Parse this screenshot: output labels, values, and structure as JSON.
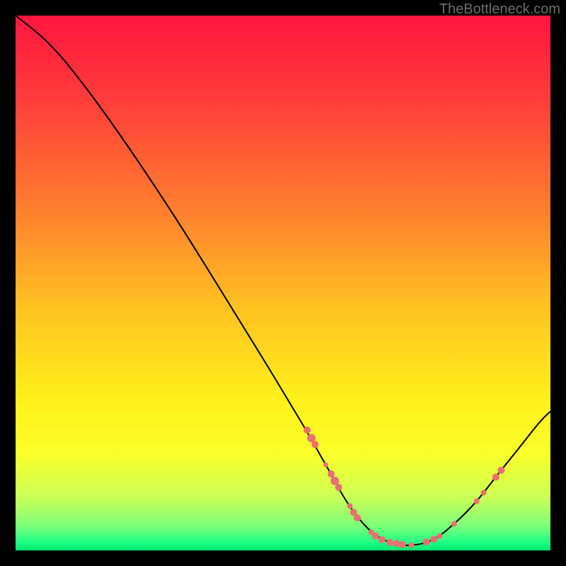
{
  "watermark": "TheBottleneck.com",
  "chart_data": {
    "type": "line",
    "title": "",
    "xlabel": "",
    "ylabel": "",
    "xlim": [
      0,
      100
    ],
    "ylim": [
      0,
      100
    ],
    "grid": false,
    "legend": false,
    "curve": [
      {
        "x": 0,
        "y": 100
      },
      {
        "x": 6,
        "y": 95
      },
      {
        "x": 12,
        "y": 88
      },
      {
        "x": 20,
        "y": 77
      },
      {
        "x": 30,
        "y": 62
      },
      {
        "x": 40,
        "y": 46
      },
      {
        "x": 48,
        "y": 33
      },
      {
        "x": 54,
        "y": 23
      },
      {
        "x": 58,
        "y": 16
      },
      {
        "x": 62,
        "y": 9
      },
      {
        "x": 66,
        "y": 4
      },
      {
        "x": 70,
        "y": 1.5
      },
      {
        "x": 74,
        "y": 1
      },
      {
        "x": 78,
        "y": 2
      },
      {
        "x": 82,
        "y": 5
      },
      {
        "x": 86,
        "y": 9
      },
      {
        "x": 90,
        "y": 14
      },
      {
        "x": 94,
        "y": 19
      },
      {
        "x": 98,
        "y": 24
      },
      {
        "x": 100,
        "y": 26
      }
    ],
    "markers": [
      {
        "x": 54.5,
        "y": 22.5,
        "r": 5
      },
      {
        "x": 55.3,
        "y": 21.0,
        "r": 6
      },
      {
        "x": 56.0,
        "y": 19.8,
        "r": 5
      },
      {
        "x": 58.0,
        "y": 16.0,
        "r": 3.5
      },
      {
        "x": 59.0,
        "y": 14.3,
        "r": 5
      },
      {
        "x": 59.7,
        "y": 13.0,
        "r": 6
      },
      {
        "x": 60.4,
        "y": 11.8,
        "r": 5
      },
      {
        "x": 62.5,
        "y": 8.3,
        "r": 4
      },
      {
        "x": 63.2,
        "y": 7.1,
        "r": 5
      },
      {
        "x": 63.9,
        "y": 6.1,
        "r": 5
      },
      {
        "x": 66.5,
        "y": 3.4,
        "r": 4
      },
      {
        "x": 67.3,
        "y": 2.7,
        "r": 5
      },
      {
        "x": 68.5,
        "y": 2.0,
        "r": 5
      },
      {
        "x": 70.0,
        "y": 1.5,
        "r": 5
      },
      {
        "x": 71.2,
        "y": 1.3,
        "r": 5
      },
      {
        "x": 72.3,
        "y": 1.1,
        "r": 5
      },
      {
        "x": 74.0,
        "y": 1.0,
        "r": 4
      },
      {
        "x": 76.8,
        "y": 1.6,
        "r": 5
      },
      {
        "x": 78.2,
        "y": 2.1,
        "r": 5
      },
      {
        "x": 79.3,
        "y": 2.7,
        "r": 4
      },
      {
        "x": 82.0,
        "y": 5.0,
        "r": 4
      },
      {
        "x": 86.2,
        "y": 9.2,
        "r": 4
      },
      {
        "x": 87.5,
        "y": 10.8,
        "r": 4
      },
      {
        "x": 89.8,
        "y": 13.7,
        "r": 5
      },
      {
        "x": 90.8,
        "y": 15.0,
        "r": 5
      }
    ],
    "colors": {
      "curve": "#000000",
      "markers": "#e97070",
      "gradient_stops": [
        {
          "offset": 0.0,
          "color": "#ff163f"
        },
        {
          "offset": 0.15,
          "color": "#ff3b3b"
        },
        {
          "offset": 0.35,
          "color": "#ff7a2f"
        },
        {
          "offset": 0.55,
          "color": "#ffc321"
        },
        {
          "offset": 0.72,
          "color": "#fff01a"
        },
        {
          "offset": 0.82,
          "color": "#f9ff2a"
        },
        {
          "offset": 0.9,
          "color": "#ccff55"
        },
        {
          "offset": 0.955,
          "color": "#7bff7b"
        },
        {
          "offset": 0.985,
          "color": "#1eff84"
        },
        {
          "offset": 1.0,
          "color": "#00e670"
        }
      ]
    }
  }
}
